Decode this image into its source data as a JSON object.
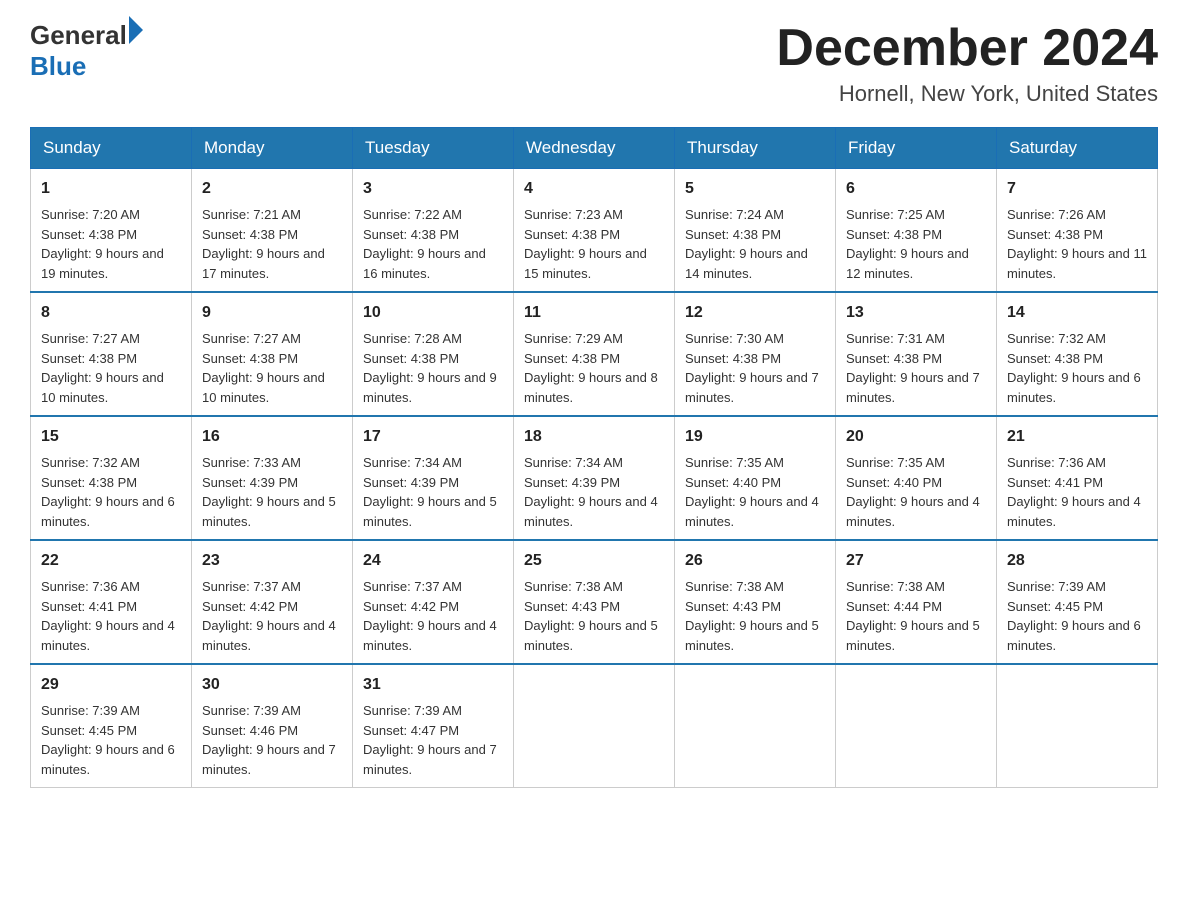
{
  "header": {
    "logo_general": "General",
    "logo_blue": "Blue",
    "month_title": "December 2024",
    "location": "Hornell, New York, United States"
  },
  "days_of_week": [
    "Sunday",
    "Monday",
    "Tuesday",
    "Wednesday",
    "Thursday",
    "Friday",
    "Saturday"
  ],
  "weeks": [
    [
      {
        "day": "1",
        "sunrise": "7:20 AM",
        "sunset": "4:38 PM",
        "daylight": "9 hours and 19 minutes."
      },
      {
        "day": "2",
        "sunrise": "7:21 AM",
        "sunset": "4:38 PM",
        "daylight": "9 hours and 17 minutes."
      },
      {
        "day": "3",
        "sunrise": "7:22 AM",
        "sunset": "4:38 PM",
        "daylight": "9 hours and 16 minutes."
      },
      {
        "day": "4",
        "sunrise": "7:23 AM",
        "sunset": "4:38 PM",
        "daylight": "9 hours and 15 minutes."
      },
      {
        "day": "5",
        "sunrise": "7:24 AM",
        "sunset": "4:38 PM",
        "daylight": "9 hours and 14 minutes."
      },
      {
        "day": "6",
        "sunrise": "7:25 AM",
        "sunset": "4:38 PM",
        "daylight": "9 hours and 12 minutes."
      },
      {
        "day": "7",
        "sunrise": "7:26 AM",
        "sunset": "4:38 PM",
        "daylight": "9 hours and 11 minutes."
      }
    ],
    [
      {
        "day": "8",
        "sunrise": "7:27 AM",
        "sunset": "4:38 PM",
        "daylight": "9 hours and 10 minutes."
      },
      {
        "day": "9",
        "sunrise": "7:27 AM",
        "sunset": "4:38 PM",
        "daylight": "9 hours and 10 minutes."
      },
      {
        "day": "10",
        "sunrise": "7:28 AM",
        "sunset": "4:38 PM",
        "daylight": "9 hours and 9 minutes."
      },
      {
        "day": "11",
        "sunrise": "7:29 AM",
        "sunset": "4:38 PM",
        "daylight": "9 hours and 8 minutes."
      },
      {
        "day": "12",
        "sunrise": "7:30 AM",
        "sunset": "4:38 PM",
        "daylight": "9 hours and 7 minutes."
      },
      {
        "day": "13",
        "sunrise": "7:31 AM",
        "sunset": "4:38 PM",
        "daylight": "9 hours and 7 minutes."
      },
      {
        "day": "14",
        "sunrise": "7:32 AM",
        "sunset": "4:38 PM",
        "daylight": "9 hours and 6 minutes."
      }
    ],
    [
      {
        "day": "15",
        "sunrise": "7:32 AM",
        "sunset": "4:38 PM",
        "daylight": "9 hours and 6 minutes."
      },
      {
        "day": "16",
        "sunrise": "7:33 AM",
        "sunset": "4:39 PM",
        "daylight": "9 hours and 5 minutes."
      },
      {
        "day": "17",
        "sunrise": "7:34 AM",
        "sunset": "4:39 PM",
        "daylight": "9 hours and 5 minutes."
      },
      {
        "day": "18",
        "sunrise": "7:34 AM",
        "sunset": "4:39 PM",
        "daylight": "9 hours and 4 minutes."
      },
      {
        "day": "19",
        "sunrise": "7:35 AM",
        "sunset": "4:40 PM",
        "daylight": "9 hours and 4 minutes."
      },
      {
        "day": "20",
        "sunrise": "7:35 AM",
        "sunset": "4:40 PM",
        "daylight": "9 hours and 4 minutes."
      },
      {
        "day": "21",
        "sunrise": "7:36 AM",
        "sunset": "4:41 PM",
        "daylight": "9 hours and 4 minutes."
      }
    ],
    [
      {
        "day": "22",
        "sunrise": "7:36 AM",
        "sunset": "4:41 PM",
        "daylight": "9 hours and 4 minutes."
      },
      {
        "day": "23",
        "sunrise": "7:37 AM",
        "sunset": "4:42 PM",
        "daylight": "9 hours and 4 minutes."
      },
      {
        "day": "24",
        "sunrise": "7:37 AM",
        "sunset": "4:42 PM",
        "daylight": "9 hours and 4 minutes."
      },
      {
        "day": "25",
        "sunrise": "7:38 AM",
        "sunset": "4:43 PM",
        "daylight": "9 hours and 5 minutes."
      },
      {
        "day": "26",
        "sunrise": "7:38 AM",
        "sunset": "4:43 PM",
        "daylight": "9 hours and 5 minutes."
      },
      {
        "day": "27",
        "sunrise": "7:38 AM",
        "sunset": "4:44 PM",
        "daylight": "9 hours and 5 minutes."
      },
      {
        "day": "28",
        "sunrise": "7:39 AM",
        "sunset": "4:45 PM",
        "daylight": "9 hours and 6 minutes."
      }
    ],
    [
      {
        "day": "29",
        "sunrise": "7:39 AM",
        "sunset": "4:45 PM",
        "daylight": "9 hours and 6 minutes."
      },
      {
        "day": "30",
        "sunrise": "7:39 AM",
        "sunset": "4:46 PM",
        "daylight": "9 hours and 7 minutes."
      },
      {
        "day": "31",
        "sunrise": "7:39 AM",
        "sunset": "4:47 PM",
        "daylight": "9 hours and 7 minutes."
      },
      null,
      null,
      null,
      null
    ]
  ]
}
